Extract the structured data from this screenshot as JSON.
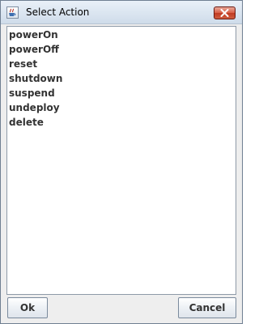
{
  "window": {
    "title": "Select Action",
    "app_icon": "java-coffee-cup-icon",
    "close_icon": "close-icon"
  },
  "actions": [
    {
      "label": "powerOn"
    },
    {
      "label": "powerOff"
    },
    {
      "label": "reset"
    },
    {
      "label": "shutdown"
    },
    {
      "label": "suspend"
    },
    {
      "label": "undeploy"
    },
    {
      "label": "delete"
    }
  ],
  "buttons": {
    "ok_label": "Ok",
    "cancel_label": "Cancel"
  },
  "colors": {
    "close_button": "#d85c44",
    "item_text": "#333333"
  }
}
